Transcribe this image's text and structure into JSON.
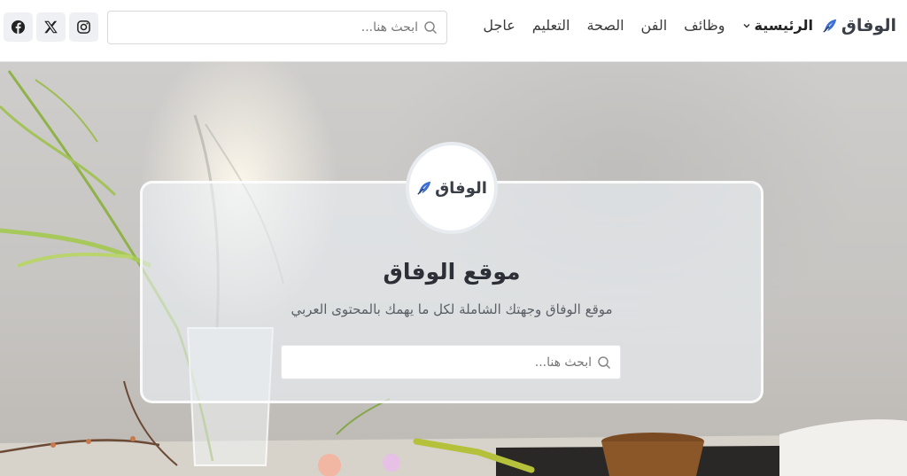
{
  "header": {
    "logo_text": "الوفاق",
    "nav": [
      {
        "label": "الرئيسية",
        "has_dropdown": true
      },
      {
        "label": "وظائف"
      },
      {
        "label": "الفن"
      },
      {
        "label": "الصحة"
      },
      {
        "label": "التعليم"
      },
      {
        "label": "عاجل"
      }
    ],
    "search": {
      "placeholder": "ابحث هنا..."
    },
    "social": [
      "facebook-icon",
      "x-icon",
      "instagram-icon"
    ]
  },
  "hero": {
    "badge_logo_text": "الوفاق",
    "title": "موقع الوفاق",
    "subtitle": "موقع الوفاق وجهتك الشاملة لكل ما يهمك بالمحتوى العربي",
    "search": {
      "placeholder": "ابحث هنا..."
    }
  },
  "colors": {
    "brand_blue": "#3b6fd4",
    "text_dark": "#2c2f35",
    "social_bg": "#eef0f3"
  }
}
